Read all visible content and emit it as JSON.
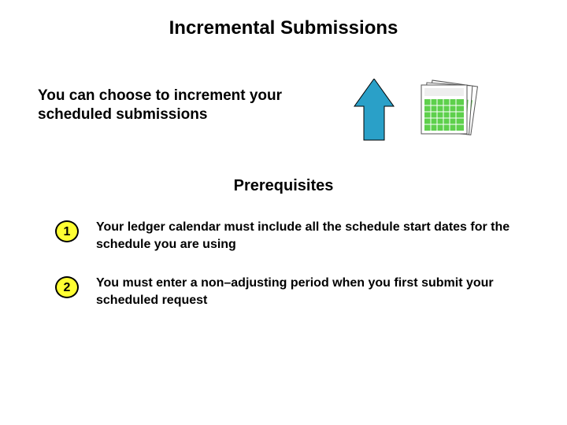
{
  "title": "Incremental Submissions",
  "intro": "You can choose to increment your scheduled submissions",
  "subhead": "Prerequisites",
  "items": [
    {
      "n": "1",
      "text": "Your ledger calendar must include all the schedule start dates for the schedule you are using"
    },
    {
      "n": "2",
      "text": "You must enter a non–adjusting period when you first submit your scheduled request"
    }
  ],
  "colors": {
    "arrow": "#2aa0c8",
    "calendar": "#5ed04c",
    "bullet": "#ffff33"
  }
}
